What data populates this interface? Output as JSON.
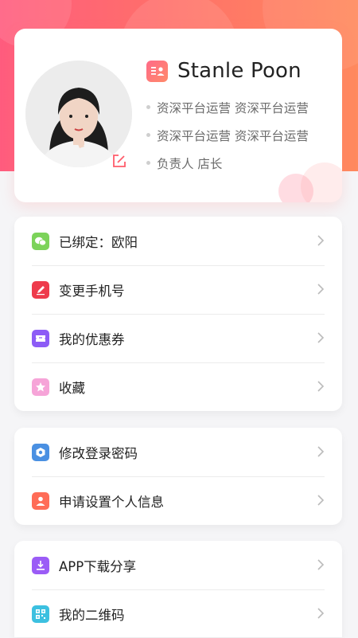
{
  "profile": {
    "name": "Stanle Poon",
    "lines": [
      "资深平台运营 资深平台运营",
      "资深平台运营 资深平台运营",
      "负责人 店长"
    ]
  },
  "groups": [
    {
      "items": [
        {
          "label": "已绑定：欧阳",
          "icon": "wechat-icon",
          "color": "#7cd35a"
        },
        {
          "label": "变更手机号",
          "icon": "pencil-icon",
          "color": "#ee3b4c"
        },
        {
          "label": "我的优惠券",
          "icon": "coupon-icon",
          "color": "#8d5cf6"
        },
        {
          "label": "收藏",
          "icon": "star-icon",
          "color": "#f6a4d8"
        }
      ]
    },
    {
      "items": [
        {
          "label": "修改登录密码",
          "icon": "shield-icon",
          "color": "#4a90e2"
        },
        {
          "label": "申请设置个人信息",
          "icon": "person-icon",
          "color": "#ff6c57"
        }
      ]
    },
    {
      "items": [
        {
          "label": "APP下载分享",
          "icon": "download-icon",
          "color": "#9b5cf6"
        },
        {
          "label": "我的二维码",
          "icon": "qr-code-icon",
          "color": "#3cc0e0"
        }
      ]
    }
  ],
  "colors": {
    "header_start": "#ff5c7e",
    "header_end": "#ff8a5e"
  }
}
